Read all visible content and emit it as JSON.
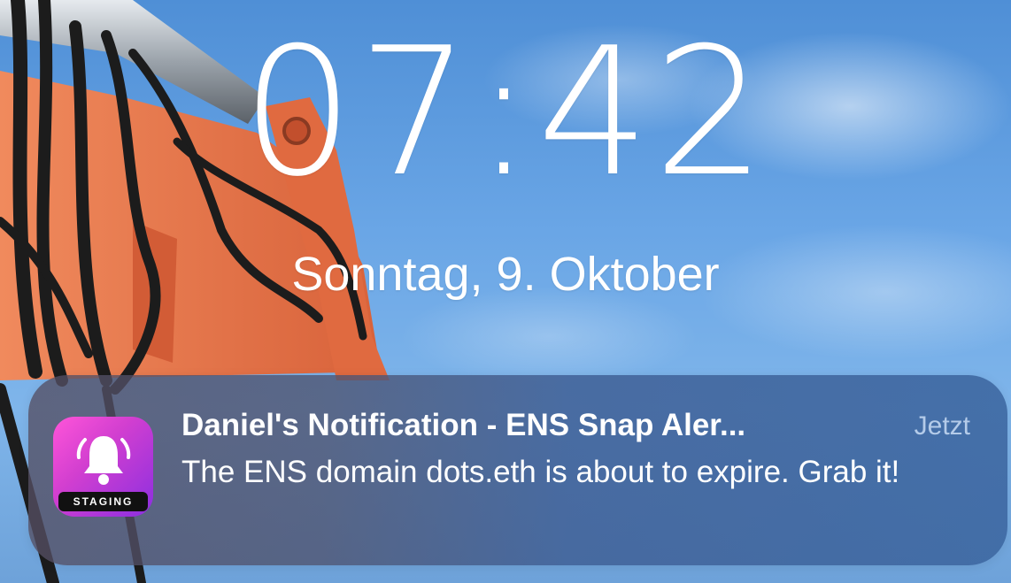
{
  "lockscreen": {
    "time": "07:42",
    "date": "Sonntag, 9. Oktober"
  },
  "notification": {
    "app_icon": "bell-icon",
    "app_badge": "STAGING",
    "title": "Daniel's Notification - ENS Snap Aler...",
    "timestamp": "Jetzt",
    "body": "The ENS domain dots.eth is about to expire. Grab it!"
  },
  "colors": {
    "sky": "#6aa6e6",
    "machine_orange": "#e8754c",
    "icon_gradient_start": "#ff55d9",
    "icon_gradient_end": "#8b2fe0"
  }
}
